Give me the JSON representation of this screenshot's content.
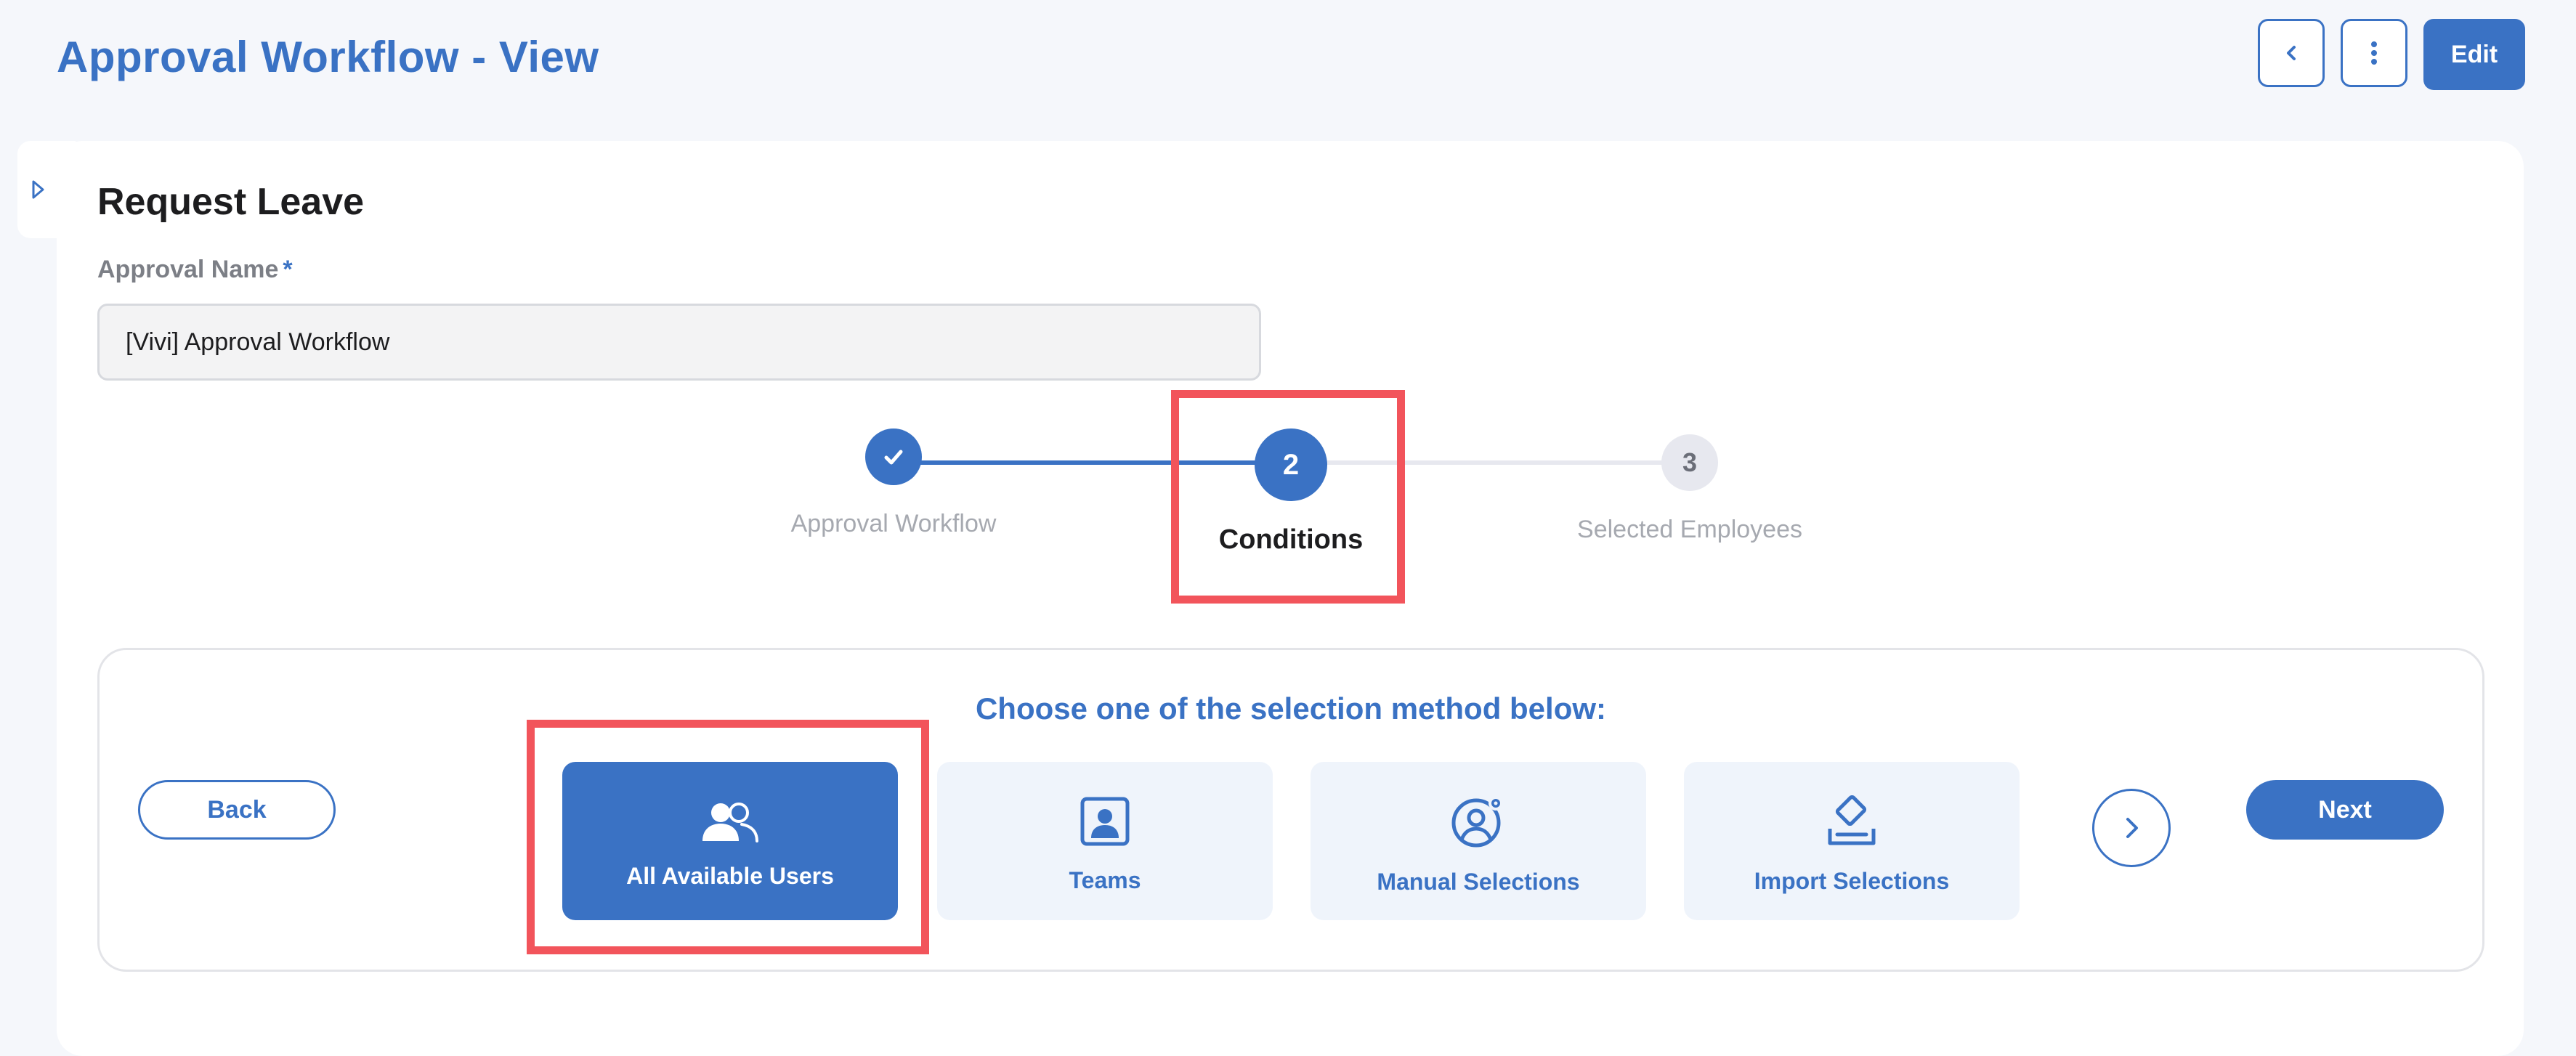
{
  "header": {
    "title": "Approval Workflow - View",
    "edit_label": "Edit",
    "back_icon": "chevron-left-icon",
    "more_icon": "more-vertical-icon"
  },
  "form": {
    "section_title": "Request Leave",
    "approval_name_label": "Approval Name",
    "required_marker": "*",
    "approval_name_value": "[Vivi] Approval Workflow"
  },
  "stepper": {
    "steps": [
      {
        "label": "Approval Workflow",
        "status": "completed"
      },
      {
        "number": "2",
        "label": "Conditions",
        "status": "active"
      },
      {
        "number": "3",
        "label": "Selected Employees",
        "status": "pending"
      }
    ]
  },
  "selection": {
    "heading": "Choose one of the selection method below:",
    "back_label": "Back",
    "next_label": "Next",
    "options": [
      {
        "label": "All Available Users",
        "icon": "users-icon",
        "selected": true
      },
      {
        "label": "Teams",
        "icon": "team-badge-icon",
        "selected": false
      },
      {
        "label": "Manual Selections",
        "icon": "user-settings-icon",
        "selected": false
      },
      {
        "label": "Import Selections",
        "icon": "import-icon",
        "selected": false
      }
    ]
  },
  "colors": {
    "primary": "#3a72c4",
    "highlight": "#f2545b",
    "option_bg": "#eff4fb"
  }
}
